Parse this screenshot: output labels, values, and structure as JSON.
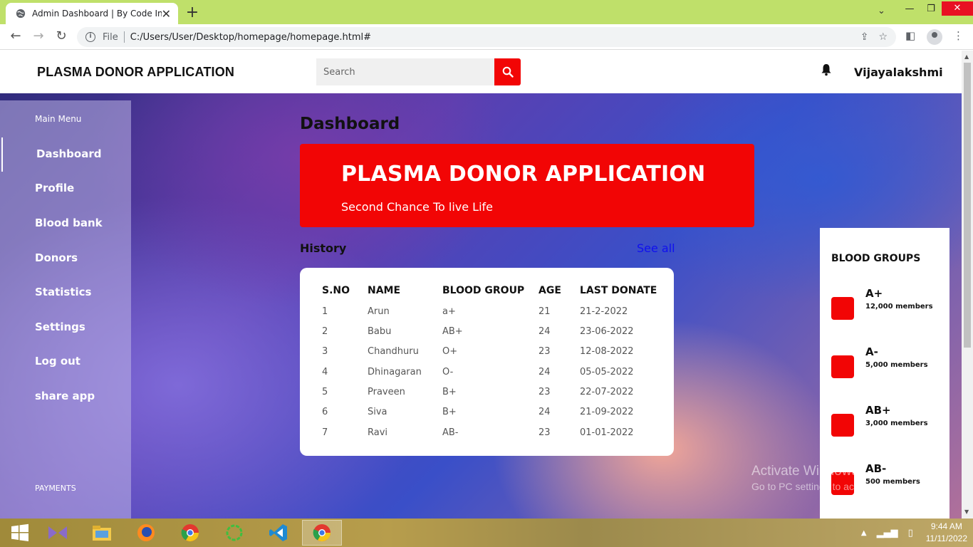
{
  "browser": {
    "tab_title": "Admin Dashboard | By Code Info",
    "scheme_label": "File",
    "url": "C:/Users/User/Desktop/homepage/homepage.html#"
  },
  "header": {
    "brand": "PLASMA DONOR APPLICATION",
    "search_placeholder": "Search",
    "username": "Vijayalakshmi"
  },
  "sidebar": {
    "heading": "Main Menu",
    "items": [
      {
        "label": "Dashboard",
        "active": true
      },
      {
        "label": "Profile"
      },
      {
        "label": "Blood bank"
      },
      {
        "label": "Donors"
      },
      {
        "label": "Statistics"
      },
      {
        "label": "Settings"
      },
      {
        "label": "Log out"
      },
      {
        "label": "share app"
      }
    ],
    "footer": "PAYMENTS"
  },
  "main": {
    "title": "Dashboard",
    "hero_title": "PLASMA DONOR APPLICATION",
    "hero_subtitle": "Second Chance To live Life",
    "history_label": "History",
    "see_all": "See all"
  },
  "table": {
    "headers": [
      "S.NO",
      "NAME",
      "BLOOD GROUP",
      "AGE",
      "LAST DONATE"
    ],
    "rows": [
      [
        "1",
        "Arun",
        "a+",
        "21",
        "21-2-2022"
      ],
      [
        "2",
        "Babu",
        "AB+",
        "24",
        "23-06-2022"
      ],
      [
        "3",
        "Chandhuru",
        "O+",
        "23",
        "12-08-2022"
      ],
      [
        "4",
        "Dhinagaran",
        "O-",
        "24",
        "05-05-2022"
      ],
      [
        "5",
        "Praveen",
        "B+",
        "23",
        "22-07-2022"
      ],
      [
        "6",
        "Siva",
        "B+",
        "24",
        "21-09-2022"
      ],
      [
        "7",
        "Ravi",
        "AB-",
        "23",
        "01-01-2022"
      ]
    ]
  },
  "blood_groups": {
    "title": "BLOOD GROUPS",
    "items": [
      {
        "name": "A+",
        "count": "12,000 members"
      },
      {
        "name": "A-",
        "count": "5,000 members"
      },
      {
        "name": "AB+",
        "count": "3,000 members"
      },
      {
        "name": "AB-",
        "count": "500 members"
      }
    ]
  },
  "watermark": {
    "line1": "Activate Windows",
    "line2": "Go to PC settings to activate Windows."
  },
  "taskbar": {
    "time": "9:44 AM",
    "date": "11/11/2022"
  },
  "colors": {
    "accent_red": "#f20505",
    "link_blue": "#1010ee",
    "tabbar_green": "#bfe06a"
  }
}
